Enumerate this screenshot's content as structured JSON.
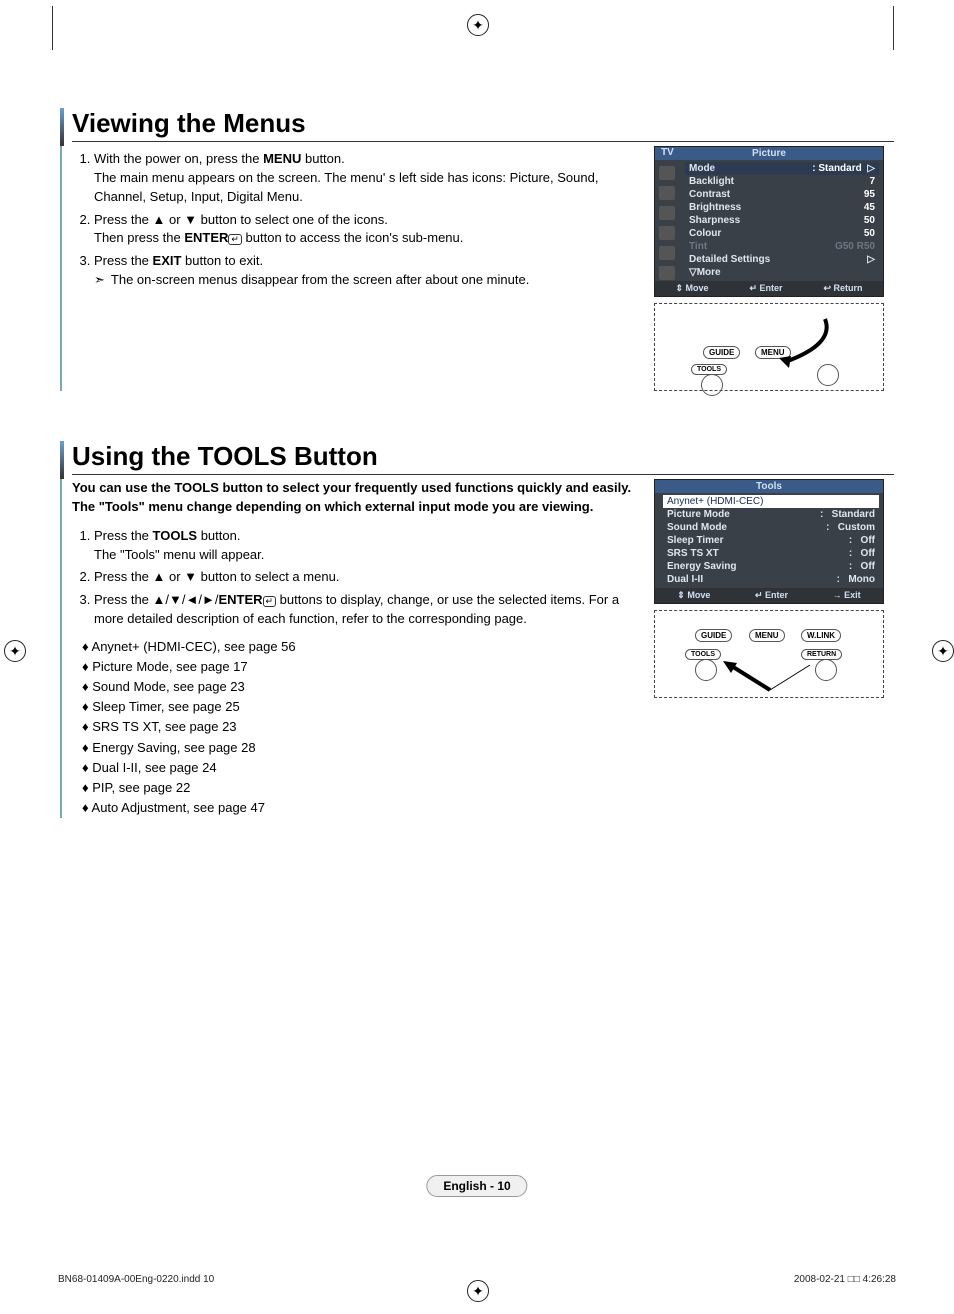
{
  "section1": {
    "title": "Viewing the Menus",
    "steps": [
      {
        "lead": "With the power on, press the ",
        "bold": "MENU",
        "tail": " button.",
        "after1": "The main menu appears on the screen. The menu' s left side has icons: Picture, Sound, Channel, Setup, Input, Digital Menu."
      },
      {
        "lead": "Press the ▲ or ▼ button to select one of the icons.",
        "after1_lead": "Then press the ",
        "after1_bold": "ENTER",
        "after1_tail": " button to access the icon's sub-menu."
      },
      {
        "lead": "Press the ",
        "bold": "EXIT",
        "tail": " button to exit.",
        "note": "The on-screen menus disappear from the screen after about one minute."
      }
    ],
    "osd": {
      "tv": "TV",
      "title": "Picture",
      "rows": [
        {
          "k": "Mode",
          "v": ": Standard",
          "sel": true,
          "arrow": "▷"
        },
        {
          "k": "Backlight",
          "v": "7"
        },
        {
          "k": "Contrast",
          "v": "95"
        },
        {
          "k": "Brightness",
          "v": "45"
        },
        {
          "k": "Sharpness",
          "v": "50"
        },
        {
          "k": "Colour",
          "v": "50"
        },
        {
          "k": "Tint",
          "v": "G50    R50",
          "tint": true
        },
        {
          "k": "Detailed Settings",
          "v": "▷"
        },
        {
          "k": "▽More",
          "v": ""
        }
      ],
      "foot": {
        "move": "Move",
        "enter": "Enter",
        "return": "Return"
      },
      "remote": {
        "guide": "GUIDE",
        "menu": "MENU",
        "tools": "TOOLS"
      }
    }
  },
  "section2": {
    "title": "Using the TOOLS Button",
    "intro": "You can use the TOOLS button to select your frequently used functions quickly and easily. The \"Tools\" menu change depending on which external input mode you are viewing.",
    "steps": [
      {
        "lead": "Press the ",
        "bold": "TOOLS",
        "tail": " button.",
        "after": "The \"Tools\" menu will appear."
      },
      {
        "lead": "Press the ▲ or ▼ button to select a menu."
      },
      {
        "lead": "Press the ▲/▼/◄/►/",
        "bold": "ENTER",
        "tail": " buttons to display, change, or use the selected items. For a more detailed description of each function, refer to the corresponding page."
      }
    ],
    "refs": [
      "Anynet+ (HDMI-CEC), see page 56",
      "Picture Mode, see page 17",
      "Sound Mode, see page 23",
      "Sleep Timer, see page 25",
      "SRS TS XT, see page 23",
      "Energy Saving, see page 28",
      "Dual I-II, see page 24",
      "PIP, see page 22",
      "Auto Adjustment, see page 47"
    ],
    "osd": {
      "title": "Tools",
      "sel": "Anynet+ (HDMI-CEC)",
      "rows": [
        {
          "k": "Picture Mode",
          "v": "Standard"
        },
        {
          "k": "Sound Mode",
          "v": "Custom"
        },
        {
          "k": "Sleep Timer",
          "v": "Off"
        },
        {
          "k": "SRS TS XT",
          "v": "Off"
        },
        {
          "k": "Energy Saving",
          "v": "Off"
        },
        {
          "k": "Dual I-II",
          "v": "Mono"
        }
      ],
      "foot": {
        "move": "Move",
        "enter": "Enter",
        "exit": "Exit"
      },
      "remote": {
        "guide": "GUIDE",
        "menu": "MENU",
        "wlink": "W.LINK",
        "tools": "TOOLS",
        "ret": "RETURN"
      }
    }
  },
  "page_label": "English - 10",
  "footer": {
    "left": "BN68-01409A-00Eng-0220.indd   10",
    "right": "2008-02-21   □□ 4:26:28"
  }
}
